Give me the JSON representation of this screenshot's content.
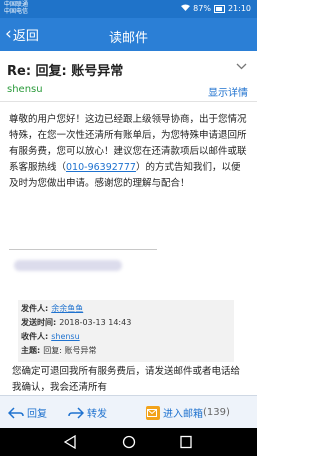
{
  "status_bar": {
    "carrier1": "中国联通",
    "carrier2": "中国电信",
    "battery": "87%",
    "time": "21:10"
  },
  "header": {
    "back_label": "返回",
    "title": "读邮件"
  },
  "email": {
    "subject": "Re: 回复:   账号异常",
    "sender": "shensu",
    "details_label": "显示详情",
    "body_before_phone": "尊敬的用户您好！这边已经跟上级领导协商，出于您情况特殊，在您一次性还清所有账单后，为您特殊申请退回所有服务费，您可以放心！建议您在还清款项后以邮件或联系客服热线（",
    "phone": "010-96392777",
    "body_after_phone": "）的方式告知我们，以便及时为您做出申请。感谢您的理解与配合！",
    "quote": {
      "from_label": "发件人:",
      "from_value": "余余鱼鱼",
      "time_label": "发送时间:",
      "time_value": "2018-03-13 14:43",
      "to_label": "收件人:",
      "to_value": "shensu",
      "subject_label": "主题:",
      "subject_value": "回复:   账号异常"
    },
    "body2": "您确定可退回我所有服务费后，请发送邮件或者电话给我确认，我会还清所有"
  },
  "toolbar": {
    "reply_label": "回复",
    "forward_label": "转发",
    "inbox_label": "进入邮箱",
    "inbox_count": "(139)"
  },
  "colors": {
    "header_blue": "#2b7fd6",
    "link_blue": "#1f72cf",
    "sender_green": "#2a9a3a"
  }
}
